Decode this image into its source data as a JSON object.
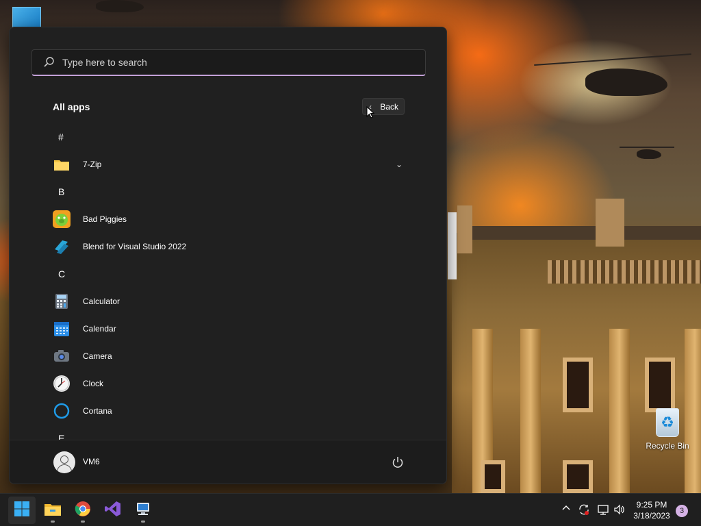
{
  "desktop": {
    "recycle_bin_label": "Recycle Bin"
  },
  "start_menu": {
    "search": {
      "placeholder": "Type here to search"
    },
    "all_apps_title": "All apps",
    "back_label": "Back",
    "list": [
      {
        "kind": "letter",
        "label": "#"
      },
      {
        "kind": "app",
        "label": "7-Zip",
        "icon": "folder-icon",
        "expandable": true
      },
      {
        "kind": "letter",
        "label": "B"
      },
      {
        "kind": "app",
        "label": "Bad Piggies",
        "icon": "bad-piggies-icon"
      },
      {
        "kind": "app",
        "label": "Blend for Visual Studio 2022",
        "icon": "blend-icon"
      },
      {
        "kind": "letter",
        "label": "C"
      },
      {
        "kind": "app",
        "label": "Calculator",
        "icon": "calculator-icon"
      },
      {
        "kind": "app",
        "label": "Calendar",
        "icon": "calendar-icon"
      },
      {
        "kind": "app",
        "label": "Camera",
        "icon": "camera-icon"
      },
      {
        "kind": "app",
        "label": "Clock",
        "icon": "clock-icon"
      },
      {
        "kind": "app",
        "label": "Cortana",
        "icon": "cortana-icon"
      },
      {
        "kind": "letter",
        "label": "E"
      }
    ],
    "footer": {
      "username": "VM6"
    }
  },
  "taskbar": {
    "apps": [
      {
        "name": "start-button",
        "icon": "windows-logo-icon"
      },
      {
        "name": "file-explorer-button",
        "icon": "file-explorer-icon"
      },
      {
        "name": "chrome-button",
        "icon": "chrome-icon"
      },
      {
        "name": "visual-studio-button",
        "icon": "visual-studio-icon"
      },
      {
        "name": "remote-desktop-button",
        "icon": "remote-desktop-icon"
      }
    ],
    "clock": {
      "time": "9:25 PM",
      "date": "3/18/2023"
    },
    "notification_count": "3"
  },
  "colors": {
    "menu_bg": "#202020",
    "accent": "#c3a0d8",
    "taskbar_bg": "#1f1f1f"
  }
}
